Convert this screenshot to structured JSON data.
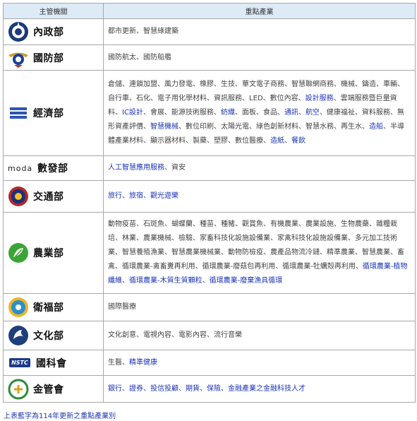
{
  "header": {
    "col_agency": "主管機關",
    "col_industry": "重點產業"
  },
  "rows": [
    {
      "agency": "內政部",
      "logo_icon": "moi-emblem-icon",
      "items": [
        {
          "t": "都市更新、智慧綠建築",
          "h": false
        }
      ]
    },
    {
      "agency": "國防部",
      "logo_icon": "mnd-emblem-icon",
      "items": [
        {
          "t": "國防航太、國防船艦",
          "h": false
        }
      ]
    },
    {
      "agency": "經濟部",
      "logo_icon": "moea-logo-icon",
      "items": [
        {
          "t": "倉儲、連鎖加盟、風力發電、橡膠、生技、華文電子商務、智慧聯網商務、機械、鑄造、車輛、自行車、石化、電子用化學材料、資訊服務、LED、數位內容、",
          "h": false
        },
        {
          "t": "設計服務",
          "h": true
        },
        {
          "t": "、雲端服務暨巨量資料、",
          "h": false
        },
        {
          "t": "IC設計",
          "h": true
        },
        {
          "t": "、會展、能源技術服務、",
          "h": false
        },
        {
          "t": "紡織",
          "h": true
        },
        {
          "t": "、面板、食品、",
          "h": false
        },
        {
          "t": "通訊",
          "h": true
        },
        {
          "t": "、",
          "h": false
        },
        {
          "t": "航空",
          "h": true
        },
        {
          "t": "、健康福祉、資料服務、無形資產評價、",
          "h": false
        },
        {
          "t": "智慧機械",
          "h": true
        },
        {
          "t": "、數位印刷、太陽光電、綠色創新材料、智慧水務、再生水、",
          "h": false
        },
        {
          "t": "造船",
          "h": true
        },
        {
          "t": "、半導體產業材料、顯示器材料、製藥、塑膠、數位醫療、",
          "h": false
        },
        {
          "t": "造紙",
          "h": true
        },
        {
          "t": "、",
          "h": false
        },
        {
          "t": "餐飲",
          "h": true
        }
      ]
    },
    {
      "agency": "數發部",
      "logo_icon": "moda-logo-icon",
      "logo_text": "moda",
      "items": [
        {
          "t": "人工智慧應用服務",
          "h": true
        },
        {
          "t": "、資安",
          "h": false
        }
      ]
    },
    {
      "agency": "交通部",
      "logo_icon": "motc-emblem-icon",
      "items": [
        {
          "t": "旅行、旅宿、觀光遊樂",
          "h": true
        }
      ]
    },
    {
      "agency": "農業部",
      "logo_icon": "moa-logo-icon",
      "items": [
        {
          "t": "動物疫苗、石斑魚、蝴蝶蘭、種苗、種豬、觀賞魚、有機農業、農業設施、生物農藥、雜糧栽培、林業、農業機械、檢驗、家畜科技化設施設備業、家禽科技化設施設備業、多元加工技術業、智慧養殖漁業、智慧農業機械業、動物防檢疫、農產品物流冷鏈、精準農業、智慧農業、畜禽、循環農業-禽畜糞再利用、循環農業-廢菇包再利用、循環農業-牡蠣殼再利用、",
          "h": false
        },
        {
          "t": "循環農業-植物纖維、循環農業-木質生質顆粒、循環農業-廢棄漁具循環",
          "h": true
        }
      ]
    },
    {
      "agency": "衛福部",
      "logo_icon": "mohw-emblem-icon",
      "items": [
        {
          "t": "國際醫療",
          "h": false
        }
      ]
    },
    {
      "agency": "文化部",
      "logo_icon": "moc-logo-icon",
      "items": [
        {
          "t": "文化創意、電視內容、電影內容、流行音樂",
          "h": false
        }
      ]
    },
    {
      "agency": "國科會",
      "logo_icon": "nstc-logo-icon",
      "logo_text": "NSTC",
      "items": [
        {
          "t": "生醫、",
          "h": false
        },
        {
          "t": "精準健康",
          "h": true
        }
      ]
    },
    {
      "agency": "金管會",
      "logo_icon": "fsc-logo-icon",
      "items": [
        {
          "t": "銀行、證券、投信投顧、期貨、保險、金融產業之金融科技人才",
          "h": true
        }
      ]
    }
  ],
  "footnote": "上表藍字為114年更新之重點產業別",
  "colors": {
    "highlight": "#1d35b5",
    "header_bg": "#dcebf6",
    "border": "#a9a9a9"
  }
}
